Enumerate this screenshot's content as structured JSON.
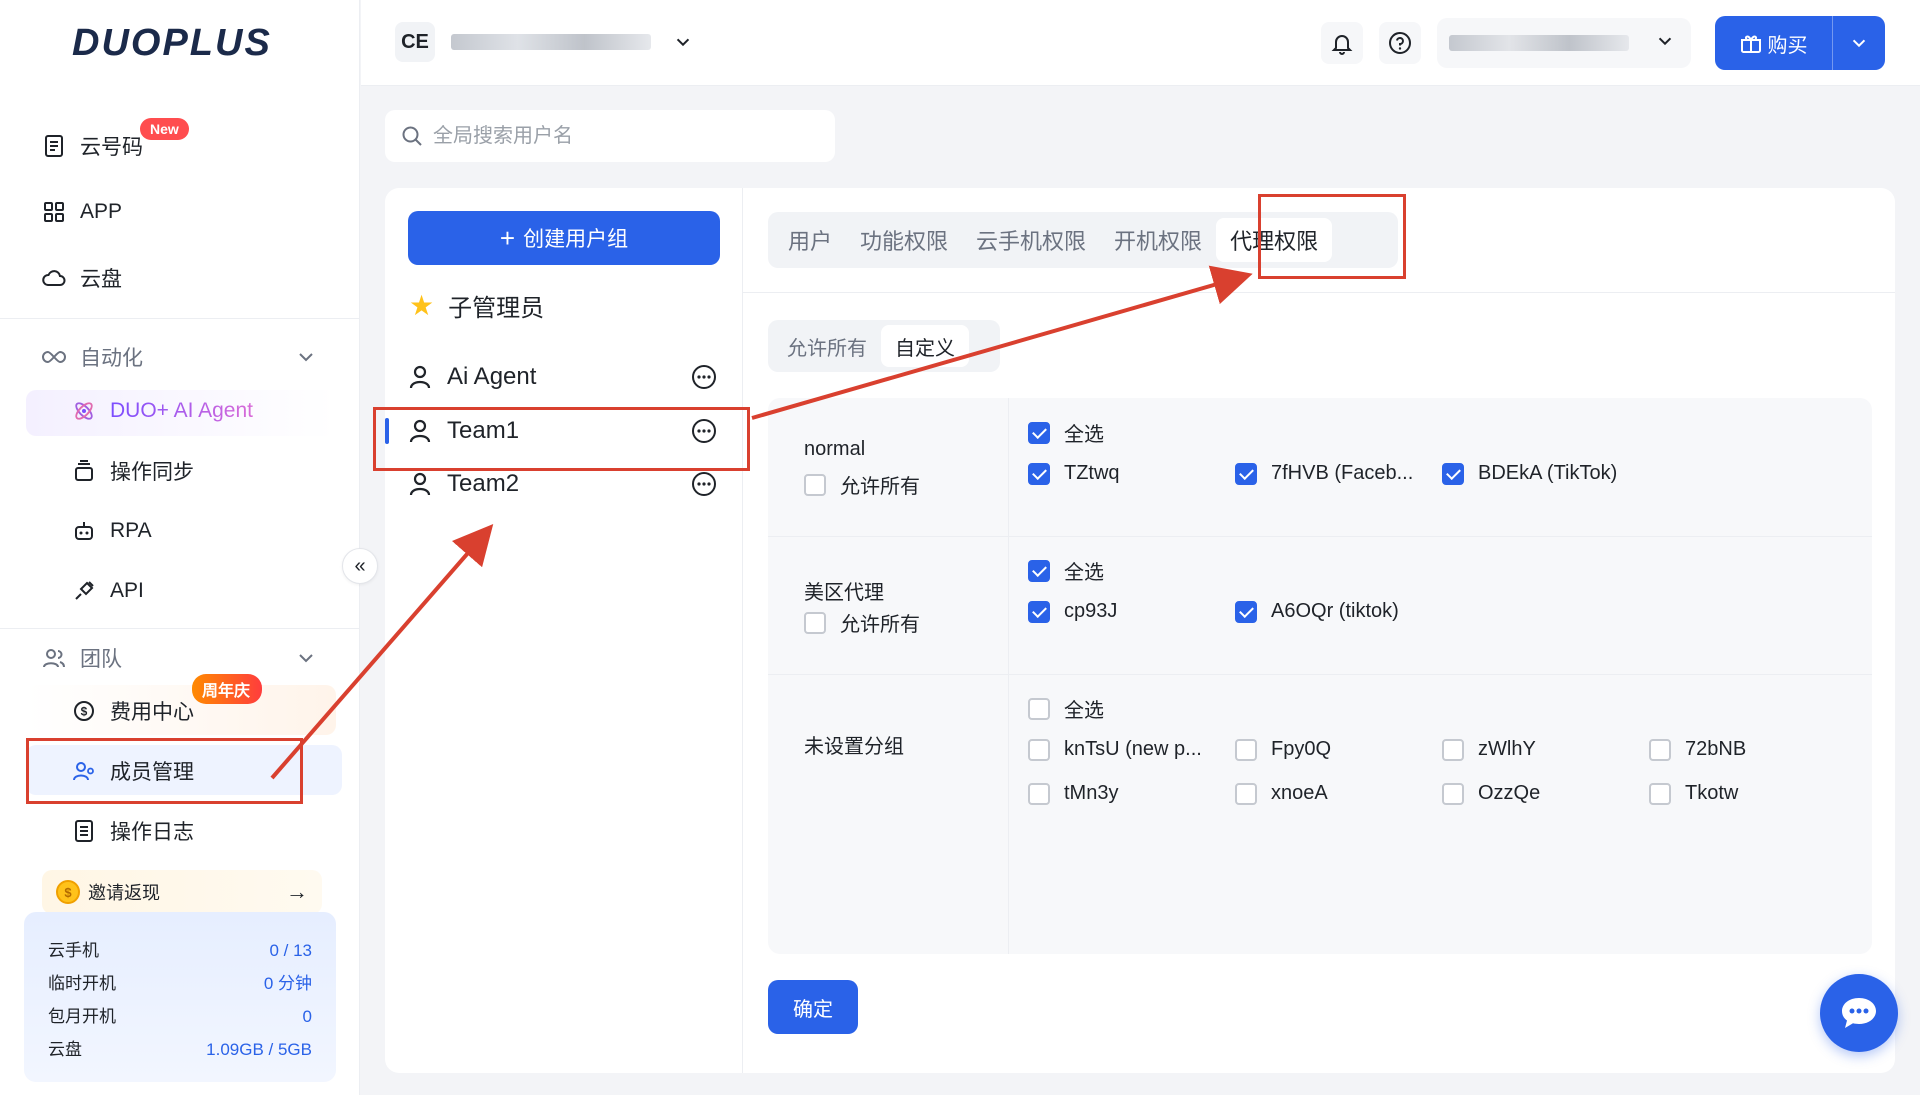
{
  "sidebar": {
    "logo": "DUOPLUS",
    "items": [
      {
        "label": "云号码",
        "badge": "New"
      },
      {
        "label": "APP"
      },
      {
        "label": "云盘"
      }
    ],
    "automation": {
      "label": "自动化",
      "children": [
        {
          "label": "DUO+ AI Agent"
        },
        {
          "label": "操作同步"
        },
        {
          "label": "RPA"
        },
        {
          "label": "API"
        }
      ]
    },
    "team": {
      "label": "团队",
      "children": [
        {
          "label": "费用中心",
          "badge": "周年庆"
        },
        {
          "label": "成员管理"
        },
        {
          "label": "操作日志"
        }
      ]
    },
    "invite": {
      "label": "邀请返现"
    },
    "stats": [
      {
        "label": "云手机",
        "value": "0 / 13"
      },
      {
        "label": "临时开机",
        "value": "0 分钟"
      },
      {
        "label": "包月开机",
        "value": "0"
      },
      {
        "label": "云盘",
        "value": "1.09GB / 5GB"
      }
    ],
    "collapse_glyph": "«"
  },
  "header": {
    "org_initials": "CE",
    "buy_label": "购买"
  },
  "search": {
    "placeholder": "全局搜索用户名"
  },
  "groups": {
    "create_label": "创建用户组",
    "sub_admin_label": "子管理员",
    "list": [
      {
        "name": "Ai Agent"
      },
      {
        "name": "Team1"
      },
      {
        "name": "Team2"
      }
    ]
  },
  "tabs": [
    {
      "label": "用户"
    },
    {
      "label": "功能权限"
    },
    {
      "label": "云手机权限"
    },
    {
      "label": "开机权限"
    },
    {
      "label": "代理权限"
    }
  ],
  "mode": {
    "options": [
      {
        "label": "允许所有"
      },
      {
        "label": "自定义"
      }
    ]
  },
  "proxy_groups": [
    {
      "name": "normal",
      "allow_all_label": "允许所有",
      "select_all_label": "全选",
      "items": [
        {
          "label": "TZtwq"
        },
        {
          "label": "7fHVB (Faceb..."
        },
        {
          "label": "BDEkA (TikTok)"
        }
      ]
    },
    {
      "name": "美区代理",
      "allow_all_label": "允许所有",
      "select_all_label": "全选",
      "items": [
        {
          "label": "cp93J"
        },
        {
          "label": "A6OQr (tiktok)"
        }
      ]
    },
    {
      "name": "未设置分组",
      "select_all_label": "全选",
      "items": [
        {
          "label": "knTsU (new p..."
        },
        {
          "label": "Fpy0Q"
        },
        {
          "label": "zWlhY"
        },
        {
          "label": "72bNB"
        },
        {
          "label": "tMn3y"
        },
        {
          "label": "xnoeA"
        },
        {
          "label": "OzzQe"
        },
        {
          "label": "Tkotw"
        }
      ]
    }
  ],
  "confirm_label": "确定",
  "colors": {
    "accent": "#2a62e8",
    "annotation": "#d9402f"
  }
}
